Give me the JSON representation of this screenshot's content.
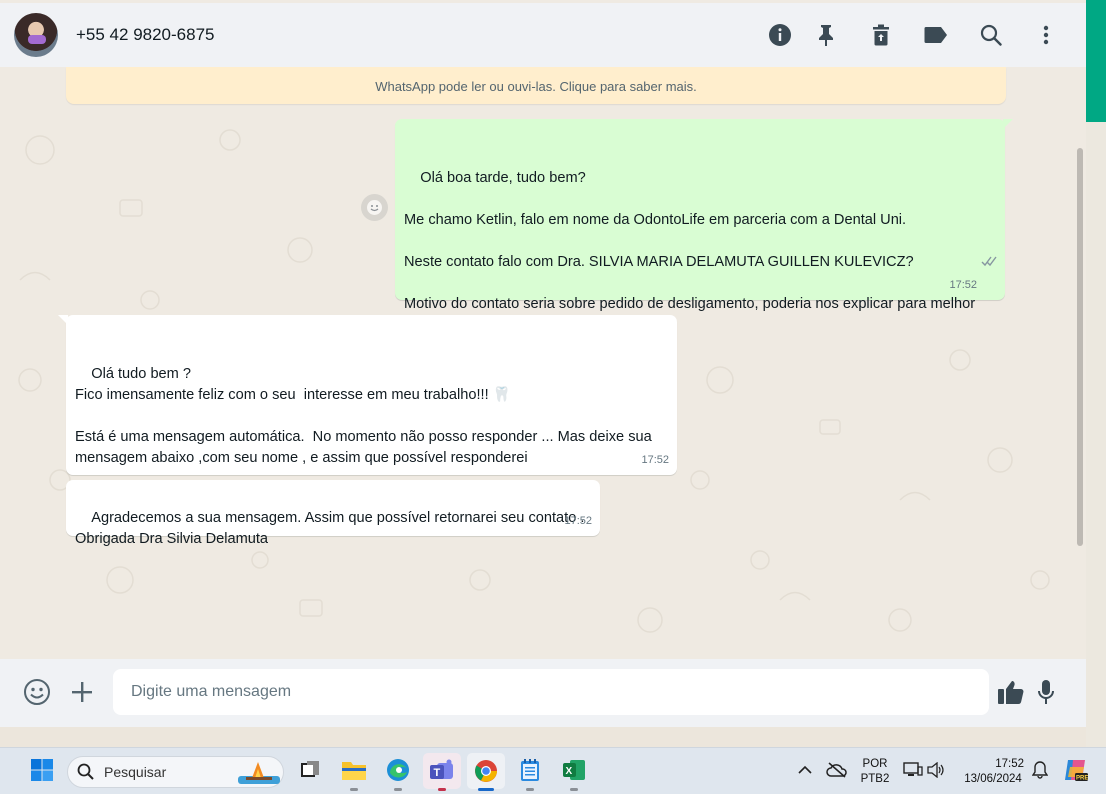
{
  "header": {
    "contact_name": "+55 42 9820-6875",
    "icons": [
      "info-icon",
      "pin-icon",
      "delete-icon",
      "label-icon",
      "search-icon",
      "menu-icon"
    ]
  },
  "banner": {
    "text": "WhatsApp pode ler ou ouvi-las. Clique para saber mais."
  },
  "messages": [
    {
      "direction": "outgoing",
      "text": "Olá boa tarde, tudo bem?\n\nMe chamo Ketlin, falo em nome da OdontoLife em parceria com a Dental Uni.\n\nNeste contato falo com Dra. SILVIA MARIA DELAMUTA GUILLEN KULEVICZ?\n\nMotivo do contato seria sobre pedido de desligamento, poderia nos explicar para melhor dar o suporte?",
      "time": "17:52",
      "status": "read"
    },
    {
      "direction": "incoming",
      "text": "Olá tudo bem ?\nFico imensamente feliz com o seu  interesse em meu trabalho!!! 🦷\n\nEstá é uma mensagem automática.  No momento não posso responder ... Mas deixe sua mensagem abaixo ,com seu nome , e assim que possível responderei\n\nObrigada Dra Silvia Delamuta",
      "time": "17:52"
    },
    {
      "direction": "incoming",
      "text": "Agradecemos a sua mensagem. Assim que possível retornarei seu contato .\nObrigada Dra Silvia Delamuta",
      "time": "17:52"
    }
  ],
  "composer": {
    "placeholder": "Digite uma mensagem"
  },
  "taskbar": {
    "search_label": "Pesquisar",
    "language_line1": "POR",
    "language_line2": "PTB2",
    "clock_time": "17:52",
    "clock_date": "13/06/2024",
    "apps": [
      "windows-start",
      "task-view",
      "file-explorer",
      "edge",
      "teams",
      "chrome",
      "notepad",
      "excel"
    ]
  },
  "colors": {
    "accent": "#00a884",
    "outgoing_bubble": "#d9fdd3",
    "incoming_bubble": "#ffffff",
    "banner": "#ffeecd",
    "chat_bg": "#efeae2"
  }
}
